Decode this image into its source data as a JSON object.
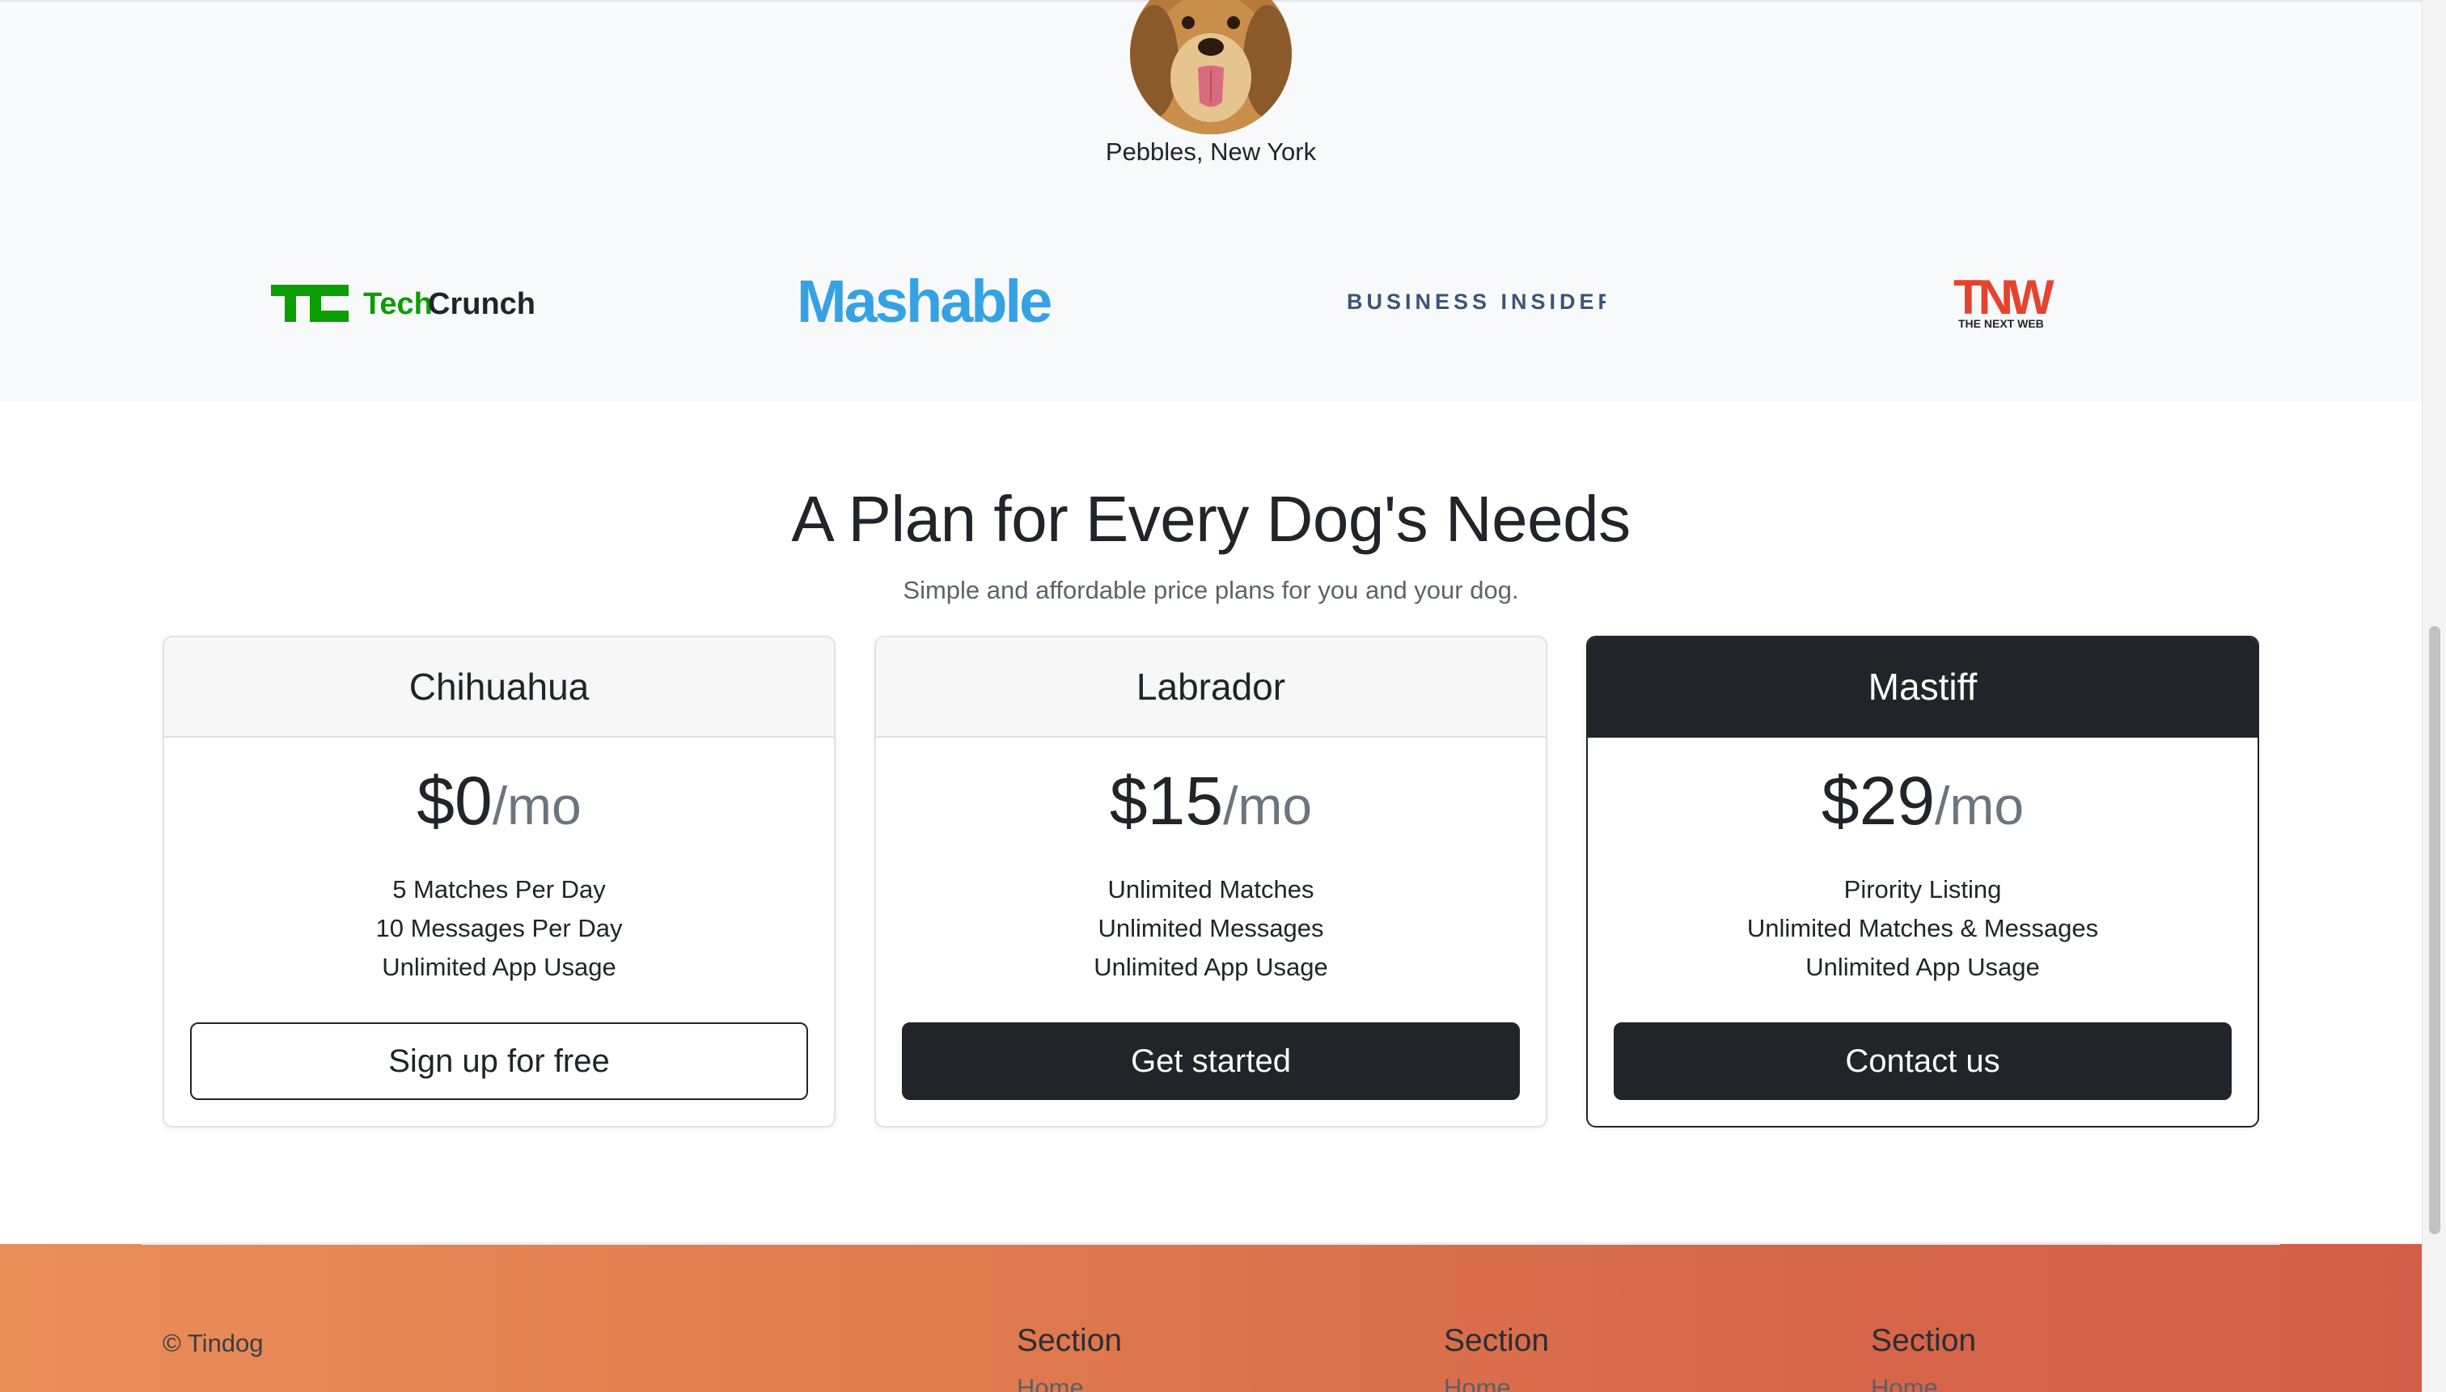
{
  "testimonial": {
    "name_location": "Pebbles, New York"
  },
  "press": {
    "logos": [
      {
        "name": "TechCrunch",
        "text_prefix": "Tech",
        "text_suffix": "Crunch",
        "mark": "TC",
        "color": "#0a9e01"
      },
      {
        "name": "Mashable",
        "text": "Mashable",
        "color": "#35a2e3"
      },
      {
        "name": "Business Insider",
        "text": "BUSINESS INSIDER",
        "color": "#3a5677"
      },
      {
        "name": "The Next Web",
        "text": "TNW",
        "subtext": "THE NEXT WEB",
        "color": "#e4442f"
      }
    ]
  },
  "pricing": {
    "title": "A Plan for Every Dog's Needs",
    "subtitle": "Simple and affordable price plans for you and your dog.",
    "plans": [
      {
        "name": "Chihuahua",
        "price": "$0",
        "period": "/mo",
        "features": [
          "5 Matches Per Day",
          "10 Messages Per Day",
          "Unlimited App Usage"
        ],
        "cta": "Sign up for free"
      },
      {
        "name": "Labrador",
        "price": "$15",
        "period": "/mo",
        "features": [
          "Unlimited Matches",
          "Unlimited Messages",
          "Unlimited App Usage"
        ],
        "cta": "Get started"
      },
      {
        "name": "Mastiff",
        "price": "$29",
        "period": "/mo",
        "features": [
          "Pirority Listing",
          "Unlimited Matches & Messages",
          "Unlimited App Usage"
        ],
        "cta": "Contact us"
      }
    ]
  },
  "footer": {
    "copyright": "© Tindog",
    "sections": [
      {
        "heading": "Section",
        "first_link": "Home"
      },
      {
        "heading": "Section",
        "first_link": "Home"
      },
      {
        "heading": "Section",
        "first_link": "Home"
      }
    ]
  },
  "colors": {
    "dark": "#212529",
    "footer_gradient_start": "#ea8e58",
    "footer_gradient_end": "#d35f48"
  }
}
